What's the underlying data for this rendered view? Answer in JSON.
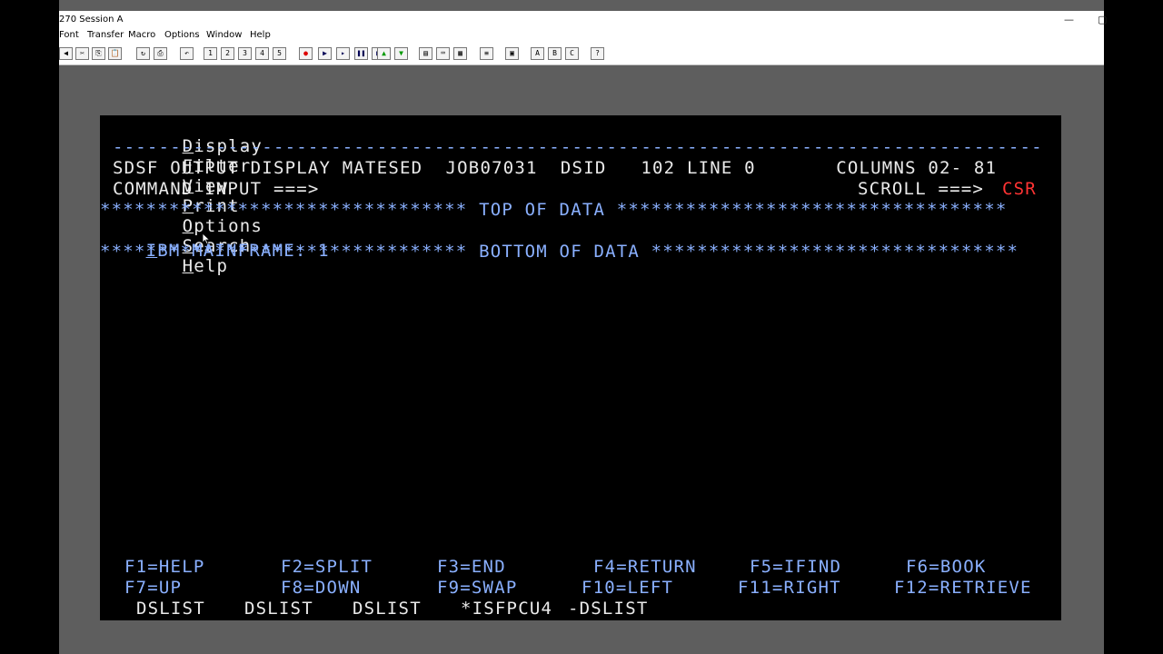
{
  "window": {
    "title": "270 Session A",
    "minimize_glyph": "—",
    "restore_glyph": "▢"
  },
  "menubar": {
    "items": [
      "Font",
      "Transfer",
      "Macro",
      "Options",
      "Window",
      "Help"
    ]
  },
  "toolbar": {
    "buttons": [
      {
        "name": "prev-icon",
        "glyph": "◀"
      },
      {
        "name": "cut-icon",
        "glyph": "✂"
      },
      {
        "name": "copy-icon",
        "glyph": "⎘"
      },
      {
        "name": "paste-icon",
        "glyph": "📋"
      },
      {
        "name": "refresh-icon",
        "glyph": "↻"
      },
      {
        "name": "print-icon",
        "glyph": "⎙"
      },
      {
        "name": "undo-icon",
        "glyph": "↶"
      },
      {
        "name": "macro-1-icon",
        "glyph": "1"
      },
      {
        "name": "macro-2-icon",
        "glyph": "2"
      },
      {
        "name": "macro-3-icon",
        "glyph": "3"
      },
      {
        "name": "macro-4-icon",
        "glyph": "4"
      },
      {
        "name": "macro-5-icon",
        "glyph": "5"
      },
      {
        "name": "record-icon",
        "glyph": "●"
      },
      {
        "name": "play-icon",
        "glyph": "▶"
      },
      {
        "name": "step-icon",
        "glyph": "▸"
      },
      {
        "name": "pause-icon",
        "glyph": "❚❚"
      },
      {
        "name": "stop-icon",
        "glyph": "■"
      },
      {
        "name": "send-icon",
        "glyph": "▲"
      },
      {
        "name": "receive-icon",
        "glyph": "▼"
      },
      {
        "name": "session-icon",
        "glyph": "▤"
      },
      {
        "name": "keyboard-icon",
        "glyph": "⌨"
      },
      {
        "name": "display-icon",
        "glyph": "▦"
      },
      {
        "name": "trace-icon",
        "glyph": "≡"
      },
      {
        "name": "map-icon",
        "glyph": "▣"
      },
      {
        "name": "key-a-icon",
        "glyph": "A"
      },
      {
        "name": "key-b-icon",
        "glyph": "B"
      },
      {
        "name": "key-c-icon",
        "glyph": "C"
      },
      {
        "name": "help-icon",
        "glyph": "?"
      }
    ]
  },
  "terminal": {
    "actionbar": {
      "items": [
        {
          "hot": "D",
          "rest": "isplay"
        },
        {
          "hot": "F",
          "rest": "ilter"
        },
        {
          "hot": "V",
          "rest": "iew"
        },
        {
          "hot": "P",
          "rest": "rint"
        },
        {
          "hot": "O",
          "rest": "ptions"
        },
        {
          "hot": "S",
          "rest": "earch"
        },
        {
          "hot": "H",
          "rest": "elp"
        }
      ]
    },
    "separator": "---------------------------------------------------------------------------------",
    "header_line": "SDSF OUTPUT DISPLAY MATESED  JOB07031  DSID   102 LINE 0       COLUMNS 02- 81",
    "command_label": "COMMAND INPUT ===>",
    "scroll_label": "SCROLL ===>",
    "scroll_value": "CSR",
    "top_of_data": "******************************** TOP OF DATA **********************************",
    "data_line_first": "I",
    "data_line_rest": "BM MAINFRAME: 1",
    "bottom_of_data": "******************************** BOTTOM OF DATA ********************************",
    "pfkeys_row1": [
      "F1=HELP",
      "F2=SPLIT",
      "F3=END",
      "F4=RETURN",
      "F5=IFIND",
      "F6=BOOK"
    ],
    "pfkeys_row2": [
      "F7=UP",
      "F8=DOWN",
      "F9=SWAP",
      "F10=LEFT",
      "F11=RIGHT",
      "F12=RETRIEVE"
    ],
    "sessions": [
      "DSLIST",
      "DSLIST",
      "DSLIST",
      "*ISFPCU4",
      "-DSLIST"
    ]
  },
  "colors": {
    "terminal_text": "#8ab0ff",
    "terminal_white": "#eaeaea",
    "scroll_value": "#ff3333"
  }
}
